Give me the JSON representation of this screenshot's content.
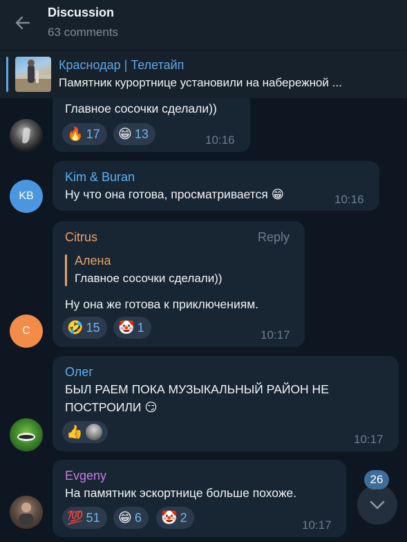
{
  "header": {
    "title": "Discussion",
    "subtitle": "63 comments"
  },
  "pinned": {
    "title": "Краснодар | Телетайп",
    "text": "Памятник курортнице установили на набережной ..."
  },
  "messages": [
    {
      "text": "Главное сосочки сделали))",
      "reactions": [
        {
          "emoji": "🔥",
          "count": "17"
        },
        {
          "emoji": "😁",
          "count": "13"
        }
      ],
      "time": "10:16"
    },
    {
      "author": "Kim & Buran",
      "avatar_initials": "KB",
      "text": "Ну что она готова, просматривается 😁",
      "time": "10:16"
    },
    {
      "author": "Citrus",
      "avatar_initials": "C",
      "reply_label": "Reply",
      "quote_author": "Алена",
      "quote_text": "Главное сосочки сделали))",
      "text": "Ну она же готова к приключениям.",
      "reactions": [
        {
          "emoji": "🤣",
          "count": "15"
        },
        {
          "emoji": "🤡",
          "count": "1"
        }
      ],
      "time": "10:17"
    },
    {
      "author": "Олег",
      "text_line1": "БЫЛ РАЕМ ПОКА МУЗЫКАЛЬНЫЙ РАЙОН НЕ",
      "text_line2": "ПОСТРОИЛИ 😏",
      "reaction_emoji": "👍",
      "time": "10:17"
    },
    {
      "author": "Evgeny",
      "text": "На памятник эскортнице больше похоже.",
      "reactions": [
        {
          "emoji": "💯",
          "count": "51"
        },
        {
          "emoji": "😁",
          "count": "6"
        },
        {
          "emoji": "🤡",
          "count": "2"
        }
      ],
      "time": "10:17"
    }
  ],
  "scroll_button": {
    "badge": "26"
  },
  "colors": {
    "background": "#0e1621",
    "bubble": "#182533",
    "accent": "#5fa7e6",
    "reaction": "#2b3a4c"
  }
}
